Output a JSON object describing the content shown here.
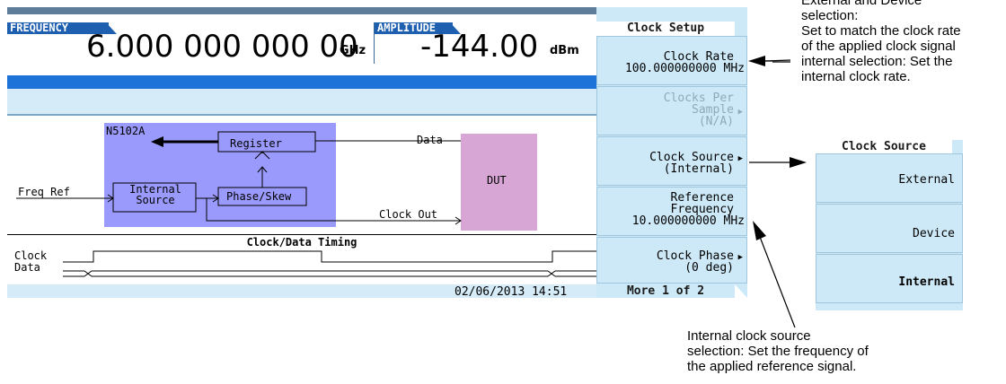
{
  "screen": {
    "frequency_label": "FREQUENCY",
    "frequency_value": "6.000 000 000 00",
    "frequency_unit": "GHz",
    "amplitude_label": "AMPLITUDE",
    "amplitude_value": "-144.00",
    "amplitude_unit": "dBm",
    "timestamp": "02/06/2013 14:51"
  },
  "diagram": {
    "module": "N5102A",
    "register": "Register",
    "internal_source_line1": "Internal",
    "internal_source_line2": "Source",
    "phase_skew": "Phase/Skew",
    "freq_ref": "Freq Ref",
    "data": "Data",
    "clock_out": "Clock Out",
    "dut": "DUT"
  },
  "timing": {
    "title": "Clock/Data Timing",
    "clock_label": "Clock",
    "data_label": "Data"
  },
  "softkeys": {
    "title": "Clock Setup",
    "clock_rate_label": "Clock Rate",
    "clock_rate_value": "100.000000000 MHz",
    "clocks_per_sample_label1": "Clocks Per",
    "clocks_per_sample_label2": "Sample",
    "clocks_per_sample_value": "(N/A)",
    "clock_source_label": "Clock Source",
    "clock_source_value": "(Internal)",
    "ref_freq_label1": "Reference",
    "ref_freq_label2": "Frequency",
    "ref_freq_value": "10.000000000 MHz",
    "clock_phase_label": "Clock Phase",
    "clock_phase_value": "(0 deg)",
    "more": "More 1 of 2"
  },
  "submenu": {
    "title": "Clock Source",
    "external": "External",
    "device": "Device",
    "internal": "Internal"
  },
  "annotations": {
    "top_right_1": "External and Device",
    "top_right_2": "selection:",
    "top_right_3": "Set to match the clock rate",
    "top_right_4": "of the applied clock signal",
    "top_right_5": "internal selection: Set the",
    "top_right_6": "internal clock rate.",
    "bottom_1": "Internal clock source",
    "bottom_2": "selection: Set the frequency of",
    "bottom_3": "the applied reference signal."
  }
}
